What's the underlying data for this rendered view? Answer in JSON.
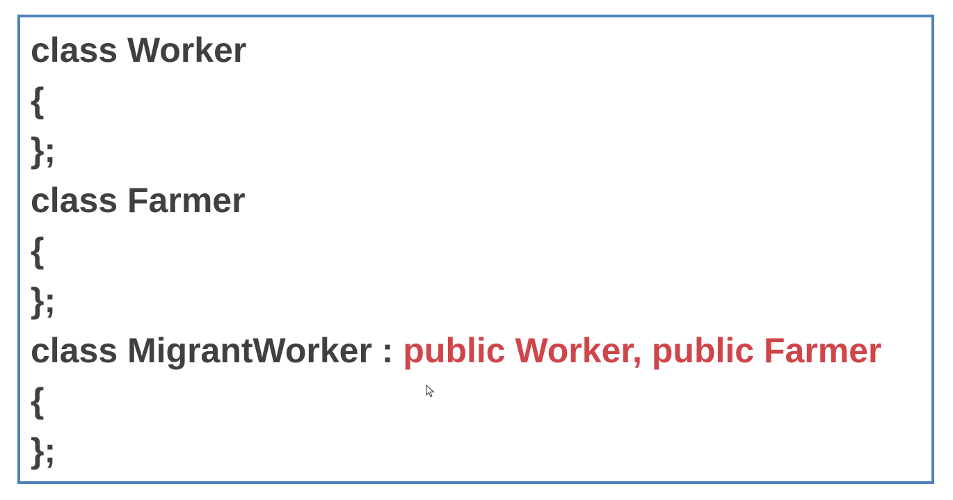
{
  "code": {
    "lines": [
      "class Worker",
      "{",
      "};",
      "class Farmer",
      "{",
      "};",
      "class MigrantWorker : ",
      "{",
      "};"
    ],
    "highlight": "public Worker, public Farmer",
    "text_color": "#404040",
    "highlight_color": "#d0454a",
    "border_color": "#4f81bd"
  },
  "cursor_icon": "mouse-pointer-icon"
}
